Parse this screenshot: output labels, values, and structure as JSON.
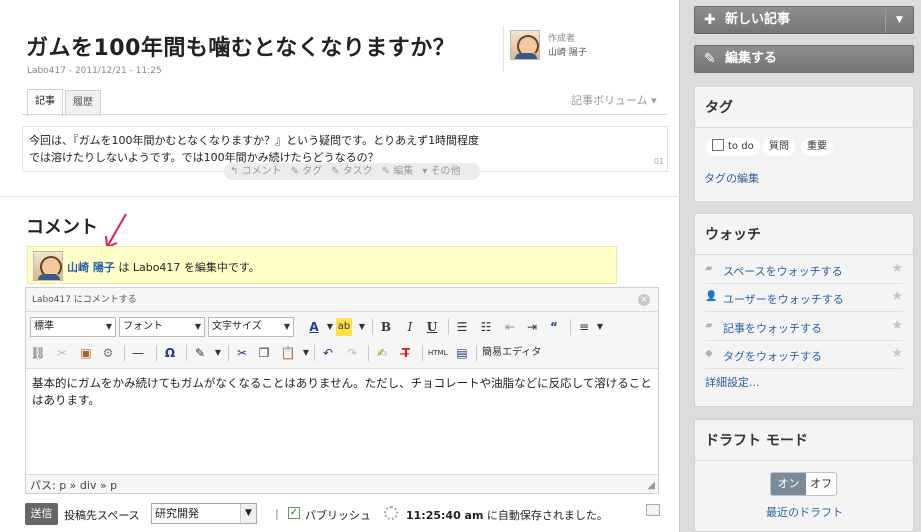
{
  "post": {
    "title": "ガムを100年間も噛むとなくなりますか？",
    "meta": "Labo417 - 2011/12/21 - 11:25",
    "author_label": "作成者",
    "author_name": "山崎 陽子",
    "tabs": [
      "記事",
      "履歴"
    ],
    "volume_label": "記事ボリューム ▾",
    "body_line1": "今回は、『ガムを100年間かむとなくなりますか？』という疑問です。とりあえず1時間程度",
    "body_line2": "では溶けたりしないようです。では100年間かみ続けたらどうなるの？",
    "body_num": "01",
    "actions": [
      "↰ コメント",
      "✎ タグ",
      "✎ タスク",
      "✎ 編集",
      "▾ その他"
    ]
  },
  "comments": {
    "heading": "コメント",
    "editing_user": "山崎 陽子",
    "editing_text": " は Labo417 を編集中です。"
  },
  "editor": {
    "header": "Labo417 にコメントする",
    "close_icon": "close-icon",
    "format_select": "標準",
    "font_select": "フォント",
    "size_select": "文字サイズ",
    "source_label": "簡易エディタ",
    "content": "基本的にガムをかみ続けてもガムがなくなることはありません。ただし、チョコレートや油脂などに反応して溶けることはあります。",
    "path": "パス: p » div » p"
  },
  "footer": {
    "send_label": "送信",
    "space_label": "投稿先スペース",
    "space_value": "研究開発",
    "publish_label": "パブリッシュ",
    "autosave_time": "11:25:40 am",
    "autosave_text": " に自動保存されました。"
  },
  "sidebar": {
    "new_post_label": "新しい記事",
    "edit_label": "編集する",
    "tags_title": "タグ",
    "tags": [
      "to do",
      "質問",
      "重要"
    ],
    "edit_tags_link": "タグの編集",
    "watch_title": "ウォッチ",
    "watch_items": [
      "スペースをウォッチする",
      "ユーザーをウォッチする",
      "記事をウォッチする",
      "タグをウォッチする"
    ],
    "watch_details_link": "詳細設定...",
    "draft_title": "ドラフト モード",
    "draft_on": "オン",
    "draft_off": "オフ",
    "recent_drafts_link": "最近のドラフト"
  }
}
